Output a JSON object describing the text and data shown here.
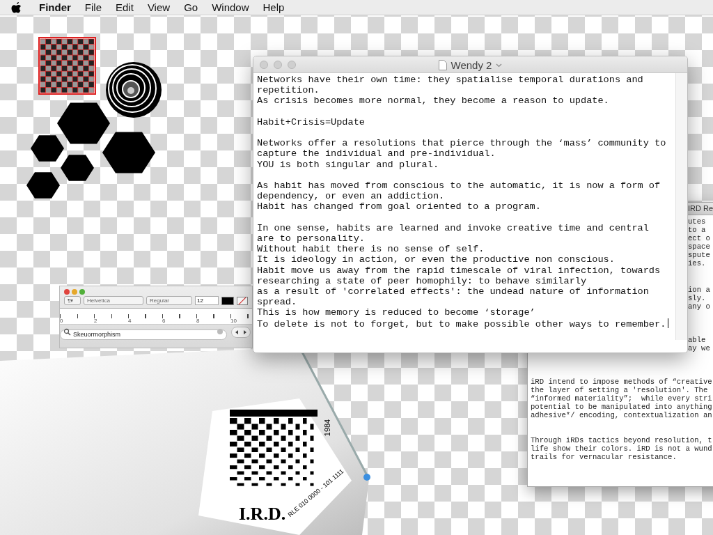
{
  "menu_bar": {
    "items": [
      {
        "label": "Finder",
        "kind": "app"
      },
      {
        "label": "File",
        "kind": "menu"
      },
      {
        "label": "Edit",
        "kind": "menu"
      },
      {
        "label": "View",
        "kind": "menu"
      },
      {
        "label": "Go",
        "kind": "menu"
      },
      {
        "label": "Window",
        "kind": "menu"
      },
      {
        "label": "Help",
        "kind": "menu"
      }
    ]
  },
  "back_window": {
    "title": "IRD Re",
    "fragment_groups": [
      [
        "utes",
        "to a",
        "ect o",
        "space",
        "spute",
        "ies."
      ],
      [
        "ion a",
        "sly.",
        "any o"
      ],
      [
        "able",
        "ay we"
      ]
    ],
    "paragraphs": [
      [
        "iRD intend to impose methods of “creative",
        "the layer of setting a 'resolution'. The",
        "“informed materiality”;  while every stri",
        "potential to be manipulated into anything",
        "adhesive*/ encoding, contextualization an"
      ],
      [
        "Through iRDs tactics beyond resolution, t",
        "life show their colors. iRD is not a wund",
        "trails for vernacular resistance."
      ]
    ]
  },
  "font_panel": {
    "paragraph_menu": "¶▾",
    "font": "Helvetica",
    "style": "Regular",
    "size": "12",
    "ruler_labels": [
      "0",
      "2",
      "4",
      "6",
      "8",
      "10"
    ],
    "search": {
      "value": "Skeuormorphism"
    }
  },
  "artwork": {
    "label": "I.R.D.",
    "year": "1984",
    "code": "RLE 010 0000 - 101 1111"
  },
  "document": {
    "title": "Wendy 2",
    "paragraphs": [
      [
        "Networks have their own time: they spatialise temporal durations and",
        "repetition.",
        "As crisis becomes more normal, they become a reason to update."
      ],
      [
        "Habit+Crisis=Update"
      ],
      [
        "Networks offer a resolutions that pierce through the ‘mass’ community to",
        "capture the individual and pre-individual.",
        "YOU is both singular and plural."
      ],
      [
        "As habit has moved from conscious to the automatic, it is now a form of",
        "dependency, or even an addiction.",
        "Habit has changed from goal oriented to a program."
      ],
      [
        "In one sense, habits are learned and invoke creative time and central",
        "are to personality.",
        "Without habit there is no sense of self.",
        "It is ideology in action, or even the productive non conscious.",
        "Habit move us away from the rapid timescale of viral infection, towards",
        "researching a state of peer homophily: to behave similarly",
        "as a result of 'correlated effects': the undead nature of information",
        "spread.",
        "This is how memory is reduced to become ‘storage’",
        "To delete is not to forget, but to make possible other ways to remember."
      ]
    ]
  }
}
